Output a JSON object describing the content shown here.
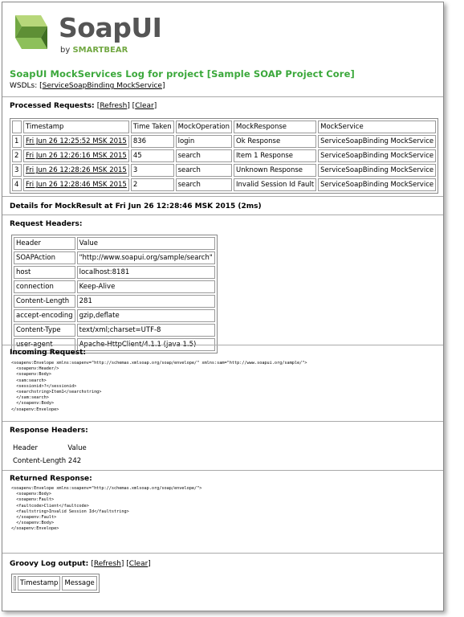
{
  "brand": {
    "name": "SoapUI",
    "by": "by",
    "company": "SMARTBEAR",
    "logo_color": "#72a843"
  },
  "page_title": "SoapUI MockServices Log for project [Sample SOAP Project Core]",
  "wsdls": {
    "label": "WSDLs:",
    "link": "ServiceSoapBinding MockService"
  },
  "processed": {
    "title": "Processed Requests:",
    "refresh": "Refresh",
    "clear": "Clear",
    "columns": [
      "Timestamp",
      "Time Taken",
      "MockOperation",
      "MockResponse",
      "MockService"
    ],
    "rows": [
      {
        "n": "1",
        "timestamp": "Fri Jun 26 12:25:52 MSK 2015",
        "time": "836",
        "op": "login",
        "resp": "Ok Response",
        "svc": "ServiceSoapBinding MockService"
      },
      {
        "n": "2",
        "timestamp": "Fri Jun 26 12:26:16 MSK 2015",
        "time": "45",
        "op": "search",
        "resp": "Item 1 Response",
        "svc": "ServiceSoapBinding MockService"
      },
      {
        "n": "3",
        "timestamp": "Fri Jun 26 12:28:26 MSK 2015",
        "time": "3",
        "op": "search",
        "resp": "Unknown Response",
        "svc": "ServiceSoapBinding MockService"
      },
      {
        "n": "4",
        "timestamp": "Fri Jun 26 12:28:46 MSK 2015",
        "time": "2",
        "op": "search",
        "resp": "Invalid Session Id Fault",
        "svc": "ServiceSoapBinding MockService"
      }
    ]
  },
  "details_title": "Details for MockResult at Fri Jun 26 12:28:46 MSK 2015 (2ms)",
  "request_headers": {
    "title": "Request Headers:",
    "columns": [
      "Header",
      "Value"
    ],
    "rows": [
      [
        "SOAPAction",
        "\"http://www.soapui.org/sample/search\""
      ],
      [
        "host",
        "localhost:8181"
      ],
      [
        "connection",
        "Keep-Alive"
      ],
      [
        "Content-Length",
        "281"
      ],
      [
        "accept-encoding",
        "gzip,deflate"
      ],
      [
        "Content-Type",
        "text/xml;charset=UTF-8"
      ],
      [
        "user-agent",
        "Apache-HttpClient/4.1.1 (java 1.5)"
      ]
    ]
  },
  "incoming": {
    "title": "Incoming Request:",
    "body": "<soapenv:Envelope xmlns:soapenv=\"http://schemas.xmlsoap.org/soap/envelope/\" xmlns:sam=\"http://www.soapui.org/sample/\">\n  <soapenv:Header/>\n  <soapenv:Body>\n  <sam:search>\n  <sessionid>?</sessionid>\n  <searchstring>Item1</searchstring>\n  </sam:search>\n  </soapenv:Body>\n</soapenv:Envelope>"
  },
  "response_headers": {
    "title": "Response Headers:",
    "col_header": "Header",
    "col_value": "Value",
    "row_name": "Content-Length",
    "row_value": "242"
  },
  "returned": {
    "title": "Returned Response:",
    "body": "<soapenv:Envelope xmlns:soapenv=\"http://schemas.xmlsoap.org/soap/envelope/\">\n  <soapenv:Body>\n  <soapenv:Fault>\n  <faultcode>Client</faultcode>\n  <faultstring>Invalid Session Id</faultstring>\n  </soapenv:Fault>\n  </soapenv:Body>\n</soapenv:Envelope>"
  },
  "groovy": {
    "title": "Groovy Log output:",
    "refresh": "Refresh",
    "clear": "Clear",
    "columns": [
      "Timestamp",
      "Message"
    ]
  }
}
